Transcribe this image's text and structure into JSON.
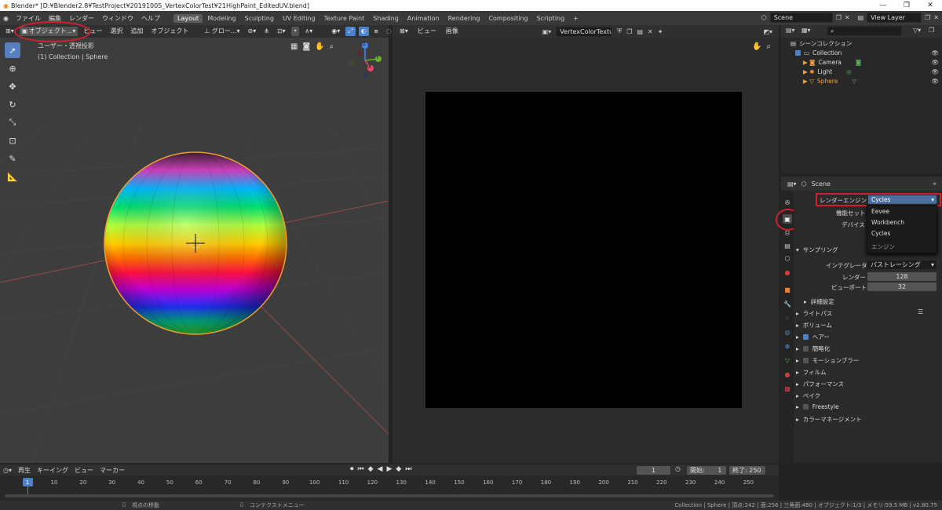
{
  "window": {
    "title": "Blender* [D:¥Blender2.8¥TestProject¥20191005_VertexColorTest¥21HighPaint_EditedUV.blend]",
    "controls": [
      "—",
      "❐",
      "✕"
    ]
  },
  "menubar": {
    "menus": [
      "ファイル",
      "編集",
      "レンダー",
      "ウィンドウ",
      "ヘルプ"
    ],
    "workspaces": [
      "Layout",
      "Modeling",
      "Sculpting",
      "UV Editing",
      "Texture Paint",
      "Shading",
      "Animation",
      "Rendering",
      "Compositing",
      "Scripting",
      "+"
    ],
    "active_workspace": "Layout",
    "scene": "Scene",
    "view_layer": "View Layer"
  },
  "viewport": {
    "mode": "オブジェクト...",
    "menus": [
      "ビュー",
      "選択",
      "追加",
      "オブジェクト"
    ],
    "orientation": "グロー...",
    "overlay_title": "ユーザー・透視投影",
    "overlay_subtitle": "(1) Collection | Sphere",
    "gizmo_axes": {
      "x": "X",
      "y": "Y",
      "z": "Z"
    }
  },
  "image_editor": {
    "menus": [
      "ビュー",
      "画像"
    ],
    "image_name": "VertexColorTexture"
  },
  "outliner": {
    "search_placeholder": "",
    "root": "シーンコレクション",
    "collection": "Collection",
    "items": [
      {
        "label": "Camera",
        "color": "#dddddd"
      },
      {
        "label": "Light",
        "color": "#dddddd"
      },
      {
        "label": "Sphere",
        "color": "#f0a040"
      }
    ]
  },
  "properties": {
    "header": "Scene",
    "render_engine_label": "レンダーエンジン",
    "render_engine_value": "Cycles",
    "feature_set_label": "機能セット",
    "device_label": "デバイス",
    "dropdown_options": [
      "Eevee",
      "Workbench",
      "Cycles"
    ],
    "dropdown_footer": "エンジン",
    "sampling": {
      "title": "サンプリング",
      "integrator_label": "インテグレータ",
      "integrator_value": "パストレーシング",
      "render_label": "レンダー",
      "render_value": "128",
      "viewport_label": "ビューポート",
      "viewport_value": "32",
      "advanced": "詳細設定"
    },
    "sections": [
      {
        "label": "ライトパス",
        "checkbox": null
      },
      {
        "label": "ボリューム",
        "checkbox": null
      },
      {
        "label": "ヘアー",
        "checkbox": true
      },
      {
        "label": "簡略化",
        "checkbox": false
      },
      {
        "label": "モーションブラー",
        "checkbox": false
      },
      {
        "label": "フィルム",
        "checkbox": null
      },
      {
        "label": "パフォーマンス",
        "checkbox": null
      },
      {
        "label": "ベイク",
        "checkbox": null
      },
      {
        "label": "Freestyle",
        "checkbox": false
      },
      {
        "label": "カラーマネージメント",
        "checkbox": null
      }
    ]
  },
  "timeline": {
    "menus": [
      "再生",
      "キーイング",
      "ビュー",
      "マーカー"
    ],
    "current_frame": "1",
    "start_label": "開始:",
    "start": "1",
    "end_label": "終了:",
    "end": "250",
    "ticks": [
      "1",
      "10",
      "20",
      "30",
      "40",
      "50",
      "60",
      "70",
      "80",
      "90",
      "100",
      "110",
      "120",
      "130",
      "140",
      "150",
      "160",
      "170",
      "180",
      "190",
      "200",
      "210",
      "220",
      "230",
      "240",
      "250"
    ]
  },
  "statusbar": {
    "left": "視点の移動",
    "middle": "コンテクストメニュー",
    "right": "Collection | Sphere | 頂点:242 | 面:256 | 三角面:480 | オブジェクト:1/3 | メモリ:59.5 MB | v2.80.75"
  },
  "colors": {
    "highlight": "#d21f2e",
    "active_blue": "#4b82ce",
    "sphere_outline": "#f0a030"
  }
}
